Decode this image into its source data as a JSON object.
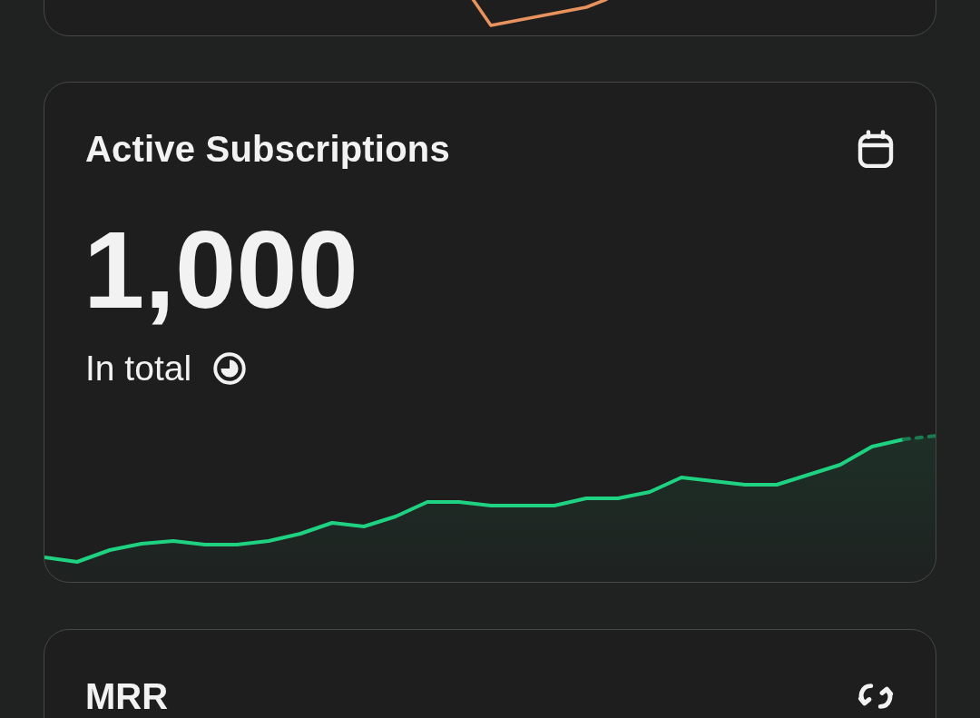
{
  "subscriptions_card": {
    "title": "Active Subscriptions",
    "value": "1,000",
    "caption": "In total"
  },
  "mrr_card": {
    "title": "MRR"
  }
}
